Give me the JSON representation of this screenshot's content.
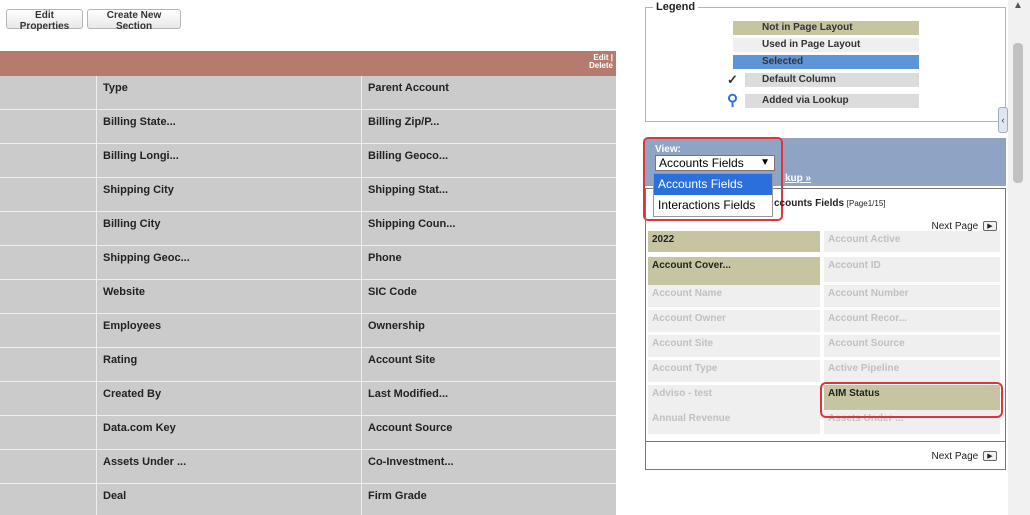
{
  "toolbar": {
    "edit_properties_label": "Edit Properties",
    "create_section_label": "Create New Section"
  },
  "section": {
    "edit_label": "Edit |",
    "delete_label": "Delete"
  },
  "field_rows": [
    [
      "Type",
      "Parent Account"
    ],
    [
      "Billing State...",
      "Billing Zip/P..."
    ],
    [
      "Billing Longi...",
      "Billing Geoco..."
    ],
    [
      "Shipping City",
      "Shipping Stat..."
    ],
    [
      "Billing City",
      "Shipping Coun..."
    ],
    [
      "Shipping Geoc...",
      "Phone"
    ],
    [
      "Website",
      "SIC Code"
    ],
    [
      "Employees",
      "Ownership"
    ],
    [
      "Rating",
      "Account Site"
    ],
    [
      "Created By",
      "Last Modified..."
    ],
    [
      "Data.com Key",
      "Account Source"
    ],
    [
      "Assets Under ...",
      "Co-Investment..."
    ],
    [
      "Deal",
      "Firm Grade"
    ]
  ],
  "legend": {
    "title": "Legend",
    "items": [
      {
        "label": "Not in Page Layout",
        "color": "#c7c5a1",
        "icon": ""
      },
      {
        "label": "Used in Page Layout",
        "color": "#efefef",
        "icon": ""
      },
      {
        "label": "Selected",
        "color": "#5e95d6",
        "icon": ""
      },
      {
        "label": "Default Column",
        "color": "#dcdcdc",
        "icon": "checkmark-icon"
      },
      {
        "label": "Added via Lookup",
        "color": "#dcdcdc",
        "icon": "magnifier-icon"
      }
    ]
  },
  "view": {
    "label": "View:",
    "selected": "Accounts Fields",
    "options": [
      "Accounts Fields",
      "Interactions Fields"
    ],
    "lookup_link": "kup »"
  },
  "fields_panel": {
    "title_visible": "ccounts Fields",
    "page_info": "[Page1/15]",
    "next_page_label": "Next Page",
    "fields": [
      {
        "label": "2022",
        "state": "not-in-layout"
      },
      {
        "label": "Account Active",
        "state": "used"
      },
      {
        "label": "Account Cover...",
        "state": "not-in-layout"
      },
      {
        "label": "Account ID",
        "state": "used"
      },
      {
        "label": "Account Name",
        "state": "used"
      },
      {
        "label": "Account Number",
        "state": "used"
      },
      {
        "label": "Account Owner",
        "state": "used"
      },
      {
        "label": "Account Recor...",
        "state": "used"
      },
      {
        "label": "Account Site",
        "state": "used"
      },
      {
        "label": "Account Source",
        "state": "used"
      },
      {
        "label": "Account Type",
        "state": "used"
      },
      {
        "label": "Active Pipeline",
        "state": "used"
      },
      {
        "label": "Adviso - test",
        "state": "used"
      },
      {
        "label": "AIM Status",
        "state": "not-in-layout"
      },
      {
        "label": "Annual Revenue",
        "state": "used"
      },
      {
        "label": "Assets Under ...",
        "state": "used"
      }
    ]
  }
}
